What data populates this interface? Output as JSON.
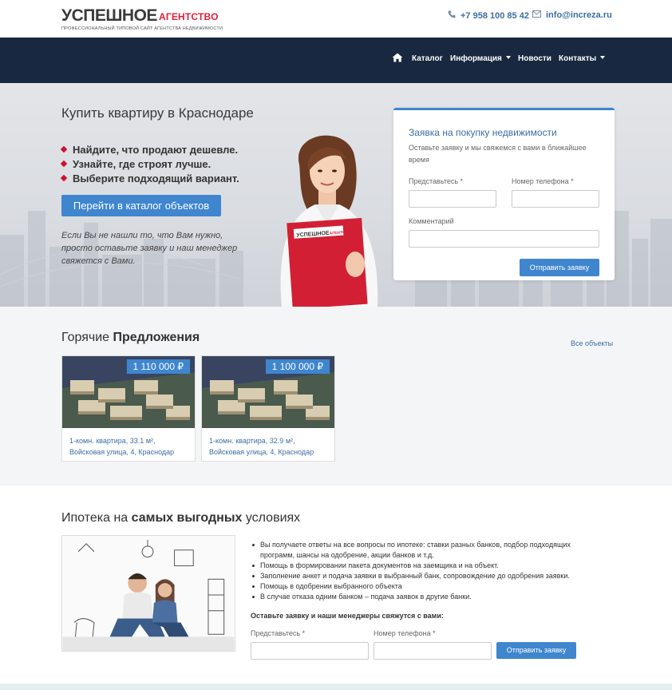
{
  "header": {
    "logo_main_1": "УСПЕШНОЕ",
    "logo_main_2": "АГЕНТСТВО",
    "logo_sub": "профессиональный типовой сайт агентства недвижимости",
    "phone": "+7 958 100 85 42",
    "email": "info@increza.ru"
  },
  "nav": {
    "items": [
      {
        "label": "Каталог",
        "dropdown": false
      },
      {
        "label": "Информация",
        "dropdown": true
      },
      {
        "label": "Новости",
        "dropdown": false
      },
      {
        "label": "Контакты",
        "dropdown": true
      }
    ]
  },
  "hero": {
    "title": "Купить квартиру в Краснодаре",
    "bullets": [
      "Найдите, что продают дешевле.",
      "Узнайте, где строят лучше.",
      "Выберите подходящий вариант."
    ],
    "cta_label": "Перейти в каталог объектов",
    "note": "Если Вы не нашли то, что Вам нужно, просто оставьте заявку и наш менеджер свяжется с Вами.",
    "folder_logo_1": "УСПЕШНОЕ",
    "folder_logo_2": "АГЕНТСТВО"
  },
  "request_form": {
    "title": "Заявка на покупку недвижимости",
    "subtitle": "Оставьте заявку и мы свяжемся с вами в ближайшее время",
    "name_label": "Представьтесь *",
    "phone_label": "Номер телефона *",
    "comment_label": "Комментарий",
    "name_value": "",
    "phone_value": "",
    "comment_value": "",
    "submit_label": "Отправить заявку"
  },
  "hot_offers": {
    "title_regular": "Горячие",
    "title_bold": "Предложения",
    "all_link": "Все объекты",
    "cards": [
      {
        "price": "1 110 000 ₽",
        "line1": "1-комн. квартира, 33.1 м²,",
        "line2": "Войсковая улица, 4, Краснодар"
      },
      {
        "price": "1 100 000 ₽",
        "line1": "1-комн. квартира, 32.9 м²,",
        "line2": "Войсковая улица, 4, Краснодар"
      }
    ]
  },
  "mortgage": {
    "title_regular_1": "Ипотека на",
    "title_bold": "самых выгодных",
    "title_regular_2": "условиях",
    "items": [
      "Вы получаете ответы на все вопросы по ипотеке: ставки разных банков, подбор подходящих программ, шансы на одобрение, акции банков и т.д.",
      "Помощь в формировании пакета документов на заемщика и на объект.",
      "Заполнение анкет и подача заявки в выбранный банк, сопровождение до одобрения заявки.",
      "Помощь в одобрении выбранного объекта",
      "В случае отказа одним банком – подача заявок в другие банки."
    ],
    "cta_text": "Оставьте заявку и наши менеджеры свяжутся с вами:",
    "name_label": "Представьтесь *",
    "phone_label": "Номер телефона *",
    "submit_label": "Отправить заявку"
  },
  "colors": {
    "navbar": "#172840",
    "accent": "#3f86cf",
    "link": "#3b6ea5",
    "logo_red": "#e21d3a",
    "bullet_red": "#d0102a"
  }
}
